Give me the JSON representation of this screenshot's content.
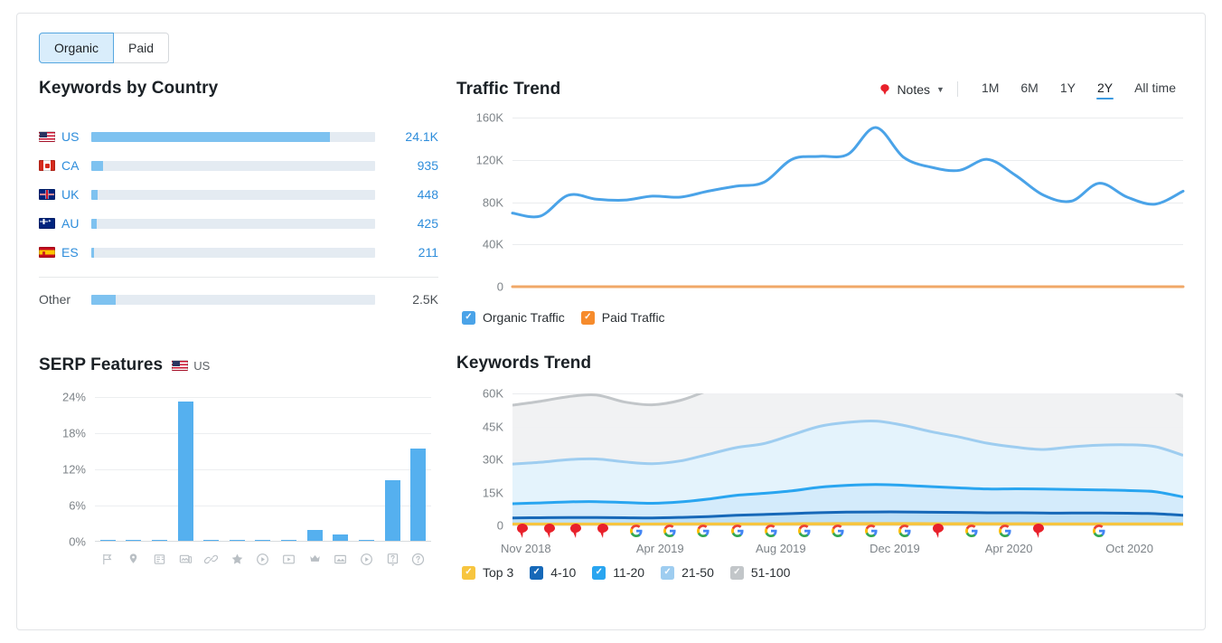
{
  "toggle": {
    "options": [
      {
        "label": "Organic",
        "active": true
      },
      {
        "label": "Paid",
        "active": false
      }
    ]
  },
  "keywords_by_country": {
    "title": "Keywords by Country",
    "rows": [
      {
        "code": "US",
        "flag": "us-flag-icon",
        "value": "24.1K",
        "pct": 84
      },
      {
        "code": "CA",
        "flag": "ca-flag-icon",
        "value": "935",
        "pct": 4.2
      },
      {
        "code": "UK",
        "flag": "uk-flag-icon",
        "value": "448",
        "pct": 2.2
      },
      {
        "code": "AU",
        "flag": "au-flag-icon",
        "value": "425",
        "pct": 1.9
      },
      {
        "code": "ES",
        "flag": "es-flag-icon",
        "value": "211",
        "pct": 1.0
      }
    ],
    "other": {
      "code": "Other",
      "value": "2.5K",
      "pct": 8.5
    }
  },
  "serp_features": {
    "title": "SERP Features",
    "country": "US",
    "country_flag": "us-flag-icon",
    "chart_data": {
      "type": "bar",
      "title": "SERP Features",
      "xlabel": "",
      "ylabel": "",
      "ylim": [
        0,
        24
      ],
      "yticks": [
        "0%",
        "6%",
        "12%",
        "18%",
        "24%"
      ],
      "grid": true,
      "categories": [
        "featured-snippet",
        "local-pack",
        "top-stories",
        "image-pack",
        "sitelinks",
        "reviews",
        "video",
        "video-carousel",
        "featured-video",
        "images",
        "instant-answer",
        "faq",
        "knowledge-panel"
      ],
      "values": [
        0.2,
        0.2,
        0.2,
        23.2,
        0.2,
        0.2,
        0.2,
        0.2,
        2.0,
        1.2,
        0.2,
        10.2,
        15.5
      ]
    }
  },
  "traffic_trend": {
    "title": "Traffic Trend",
    "notes_label": "Notes",
    "notes_icon": "pin-icon",
    "caret_icon": "chevron-down-icon",
    "ranges": [
      {
        "label": "1M",
        "active": false
      },
      {
        "label": "6M",
        "active": false
      },
      {
        "label": "1Y",
        "active": false
      },
      {
        "label": "2Y",
        "active": true
      },
      {
        "label": "All time",
        "active": false
      }
    ],
    "legend": [
      {
        "label": "Organic Traffic",
        "color": "#4aa3e8",
        "checked": true
      },
      {
        "label": "Paid Traffic",
        "color": "#f68b2c",
        "checked": true
      }
    ],
    "chart_data": {
      "type": "line",
      "title": "Traffic Trend",
      "xlabel": "",
      "ylabel": "",
      "ylim": [
        0,
        170000
      ],
      "yticks": [
        "0",
        "40K",
        "80K",
        "120K",
        "160K"
      ],
      "ytick_values": [
        0,
        40000,
        80000,
        120000,
        160000
      ],
      "grid": true,
      "legend_position": "bottom",
      "series": [
        {
          "name": "Organic Traffic",
          "color": "#4aa3e8",
          "values": [
            74000,
            71000,
            92000,
            88000,
            87000,
            91000,
            90000,
            96000,
            101000,
            105000,
            128000,
            131000,
            133000,
            160000,
            130000,
            120000,
            117000,
            128000,
            112000,
            92000,
            86000,
            104000,
            90000,
            83000,
            96000
          ]
        },
        {
          "name": "Paid Traffic",
          "color": "#f0a868",
          "values": [
            0,
            0,
            0,
            0,
            0,
            0,
            0,
            0,
            0,
            0,
            0,
            0,
            0,
            0,
            0,
            0,
            0,
            0,
            0,
            0,
            0,
            0,
            0,
            0,
            0
          ]
        }
      ]
    }
  },
  "keywords_trend": {
    "title": "Keywords Trend",
    "legend": [
      {
        "label": "Top 3",
        "color": "#f7c53f",
        "checked": true
      },
      {
        "label": "4-10",
        "color": "#1668b8",
        "checked": true
      },
      {
        "label": "11-20",
        "color": "#29a5f0",
        "checked": true
      },
      {
        "label": "21-50",
        "color": "#9ecdf0",
        "checked": true
      },
      {
        "label": "51-100",
        "color": "#c2c6c9",
        "checked": true
      }
    ],
    "chart_data": {
      "type": "area",
      "title": "Keywords Trend",
      "xlabel": "",
      "ylabel": "",
      "ylim": [
        0,
        65000
      ],
      "yticks": [
        "0",
        "15K",
        "30K",
        "45K",
        "60K"
      ],
      "ytick_values": [
        0,
        15000,
        30000,
        45000,
        60000
      ],
      "grid": true,
      "legend_position": "bottom",
      "xticks": [
        "Nov 2018",
        "Apr 2019",
        "Aug 2019",
        "Dec 2019",
        "Apr 2020",
        "Oct 2020"
      ],
      "xtick_positions": [
        2,
        22,
        40,
        57,
        74,
        92
      ],
      "series": [
        {
          "name": "Top 3",
          "color": "#f7c53f",
          "values": [
            700,
            700,
            700,
            700,
            700,
            700,
            750,
            750,
            800,
            800,
            850,
            900,
            950,
            950,
            950,
            900,
            900,
            850,
            850,
            800,
            800,
            800,
            800,
            800,
            800
          ]
        },
        {
          "name": "4-10",
          "color": "#1668b8",
          "values": [
            3000,
            3100,
            3200,
            3200,
            3100,
            3000,
            3200,
            3600,
            4200,
            4600,
            5000,
            5400,
            5600,
            5700,
            5700,
            5600,
            5500,
            5400,
            5400,
            5300,
            5300,
            5300,
            5200,
            5000,
            4200
          ]
        },
        {
          "name": "11-20",
          "color": "#29a5f0",
          "values": [
            7000,
            7300,
            7700,
            7800,
            7500,
            7200,
            7600,
            8600,
            9800,
            10400,
            11200,
            12500,
            13200,
            13500,
            13100,
            12600,
            12100,
            11700,
            11800,
            11800,
            11600,
            11400,
            11200,
            10800,
            9000
          ]
        },
        {
          "name": "21-50",
          "color": "#9ecdf0",
          "values": [
            19500,
            20000,
            20800,
            21000,
            20000,
            19500,
            20200,
            22000,
            23500,
            24500,
            27500,
            30000,
            31000,
            31200,
            29500,
            27000,
            25000,
            22500,
            20500,
            19500,
            21000,
            22000,
            22500,
            22200,
            20500
          ]
        },
        {
          "name": "51-100",
          "color": "#c2c6c9",
          "values": [
            29000,
            30000,
            31000,
            31500,
            29500,
            29000,
            29800,
            31500,
            33500,
            35000,
            40500,
            43500,
            44800,
            45000,
            43000,
            39000,
            35500,
            34000,
            32500,
            29500,
            29500,
            31500,
            31800,
            31500,
            29000
          ]
        }
      ],
      "markers": [
        {
          "type": "note",
          "x": 1.5
        },
        {
          "type": "note",
          "x": 5.5
        },
        {
          "type": "note",
          "x": 9.5
        },
        {
          "type": "note",
          "x": 13.5
        },
        {
          "type": "google",
          "x": 18.5
        },
        {
          "type": "google",
          "x": 23.5
        },
        {
          "type": "google",
          "x": 28.5
        },
        {
          "type": "google",
          "x": 33.5
        },
        {
          "type": "google",
          "x": 38.5
        },
        {
          "type": "google",
          "x": 43.5
        },
        {
          "type": "google",
          "x": 48.5
        },
        {
          "type": "google",
          "x": 53.5
        },
        {
          "type": "google",
          "x": 58.5
        },
        {
          "type": "note",
          "x": 63.5
        },
        {
          "type": "google",
          "x": 68.5
        },
        {
          "type": "google",
          "x": 73.5
        },
        {
          "type": "note",
          "x": 78.5
        },
        {
          "type": "google",
          "x": 87.5
        }
      ]
    }
  }
}
